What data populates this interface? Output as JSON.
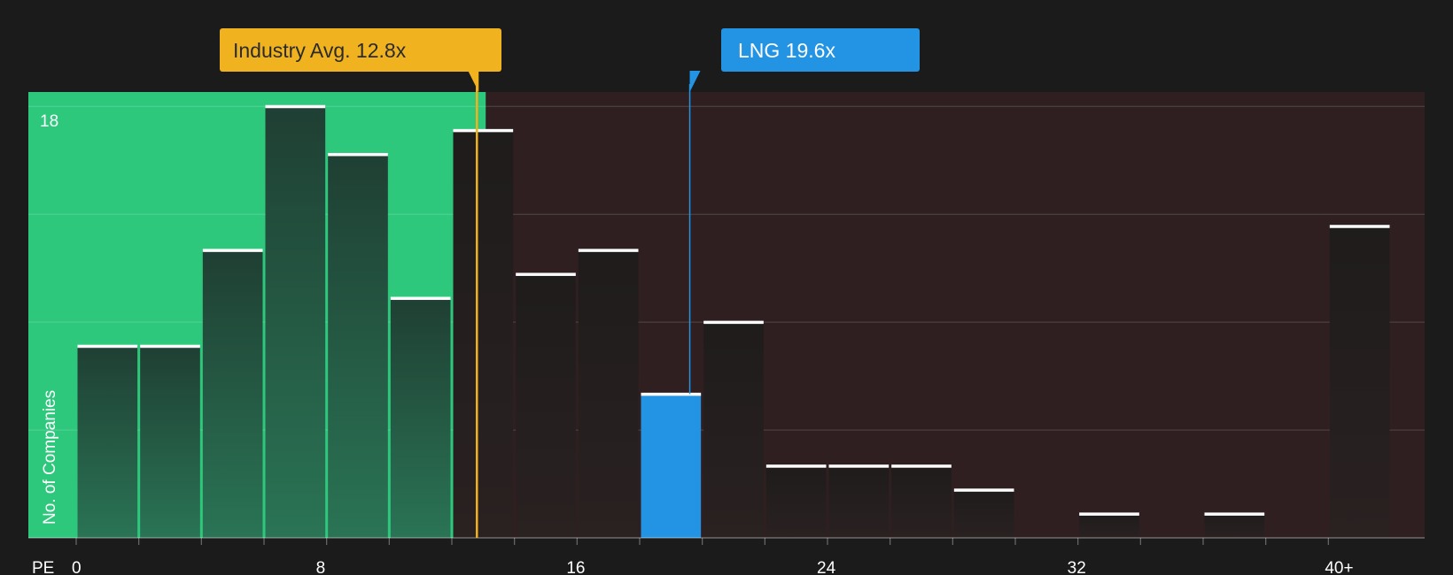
{
  "chart_data": {
    "type": "bar",
    "x_axis_label": "PE",
    "y_axis_label": "No. of Companies",
    "y_max_label": "18",
    "ylim": [
      0,
      18.6
    ],
    "x_ticks": [
      "0",
      "8",
      "16",
      "24",
      "32",
      "40+"
    ],
    "bins": [
      {
        "start": 0,
        "end": 2,
        "count": 8
      },
      {
        "start": 2,
        "end": 4,
        "count": 8
      },
      {
        "start": 4,
        "end": 6,
        "count": 12
      },
      {
        "start": 6,
        "end": 8,
        "count": 18
      },
      {
        "start": 8,
        "end": 10,
        "count": 16
      },
      {
        "start": 10,
        "end": 12,
        "count": 10
      },
      {
        "start": 12,
        "end": 14,
        "count": 17
      },
      {
        "start": 14,
        "end": 16,
        "count": 11
      },
      {
        "start": 16,
        "end": 18,
        "count": 12
      },
      {
        "start": 18,
        "end": 20,
        "count": 6,
        "highlight": true
      },
      {
        "start": 20,
        "end": 22,
        "count": 9
      },
      {
        "start": 22,
        "end": 24,
        "count": 3
      },
      {
        "start": 24,
        "end": 26,
        "count": 3
      },
      {
        "start": 26,
        "end": 28,
        "count": 3
      },
      {
        "start": 28,
        "end": 30,
        "count": 2
      },
      {
        "start": 30,
        "end": 32,
        "count": 0
      },
      {
        "start": 32,
        "end": 34,
        "count": 1
      },
      {
        "start": 34,
        "end": 36,
        "count": 0
      },
      {
        "start": 36,
        "end": 38,
        "count": 1
      },
      {
        "start": 38,
        "end": 40,
        "count": 0
      },
      {
        "start": 40,
        "end": 42,
        "count": 13
      }
    ],
    "industry_avg": {
      "label": "Industry Avg. 12.8x",
      "value": 12.8
    },
    "company": {
      "label": "LNG 19.6x",
      "value": 19.6
    },
    "colors": {
      "background": "#1b1b1b",
      "green_zone": "#2ec87d",
      "red_zone": "#2f1f20",
      "industry": "#f0b21e",
      "company": "#2394e3",
      "bar_in_green": "#1f3e33",
      "bar_in_red": "#242020",
      "bar_cap": "#ffffff"
    }
  }
}
